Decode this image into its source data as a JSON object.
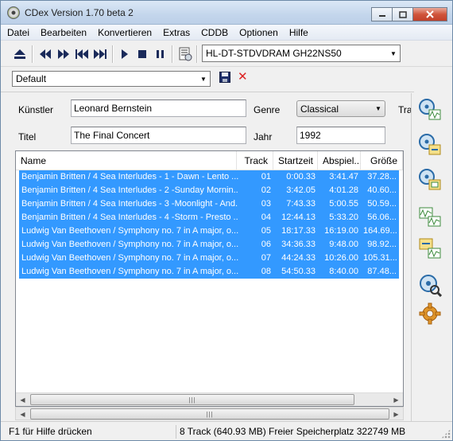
{
  "window": {
    "title": "CDex Version 1.70 beta 2"
  },
  "menu": [
    "Datei",
    "Bearbeiten",
    "Konvertieren",
    "Extras",
    "CDDB",
    "Optionen",
    "Hilfe"
  ],
  "toolbar": {
    "drive": "HL-DT-STDVDRAM GH22NS50",
    "icons": [
      "eject-icon",
      "rewind-icon",
      "fast-forward-icon",
      "skip-back-icon",
      "skip-forward-icon",
      "play-icon",
      "stop-icon",
      "pause-icon",
      "cd-info-icon"
    ]
  },
  "profile": {
    "selected": "Default"
  },
  "form": {
    "artist_label": "Künstler",
    "artist_value": "Leonard Bernstein",
    "title_label": "Titel",
    "title_value": "The Final Concert",
    "genre_label": "Genre",
    "genre_value": "Classical",
    "year_label": "Jahr",
    "year_value": "1992",
    "track_label_partial": "Tra"
  },
  "tracklist": {
    "columns": [
      "Name",
      "Track",
      "Startzeit",
      "Abspiel...",
      "Größe"
    ],
    "rows": [
      {
        "name": "Benjamin Britten / 4 Sea Interludes - 1 - Dawn - Lento ...",
        "track": "01",
        "start": "0:00.33",
        "play": "3:41.47",
        "size": "37.28..."
      },
      {
        "name": "Benjamin Britten / 4 Sea Interludes - 2 -Sunday Mornin...",
        "track": "02",
        "start": "3:42.05",
        "play": "4:01.28",
        "size": "40.60..."
      },
      {
        "name": "Benjamin Britten / 4 Sea Interludes - 3 -Moonlight - And...",
        "track": "03",
        "start": "7:43.33",
        "play": "5:00.55",
        "size": "50.59..."
      },
      {
        "name": "Benjamin Britten / 4 Sea Interludes - 4 -Storm - Presto ...",
        "track": "04",
        "start": "12:44.13",
        "play": "5:33.20",
        "size": "56.06..."
      },
      {
        "name": "Ludwig Van Beethoven / Symphony no. 7 in A major, o...",
        "track": "05",
        "start": "18:17.33",
        "play": "16:19.00",
        "size": "164.69..."
      },
      {
        "name": "Ludwig Van Beethoven / Symphony no. 7 in A major, o...",
        "track": "06",
        "start": "34:36.33",
        "play": "9:48.00",
        "size": "98.92..."
      },
      {
        "name": "Ludwig Van Beethoven / Symphony no. 7 in A major, o...",
        "track": "07",
        "start": "44:24.33",
        "play": "10:26.00",
        "size": "105.31..."
      },
      {
        "name": "Ludwig Van Beethoven / Symphony no. 7 in A major, o...",
        "track": "08",
        "start": "54:50.33",
        "play": "8:40.00",
        "size": "87.48..."
      }
    ]
  },
  "side_actions": [
    "rip-to-wav-icon",
    "rip-to-compressed-icon",
    "rip-partial-icon",
    "convert-wav-icon",
    "convert-compressed-icon",
    "playlist-icon",
    "settings-gear-icon"
  ],
  "status": {
    "help": "F1 für Hilfe drücken",
    "summary": "8 Track (640.93 MB) Freier Speicherplatz 322749 MB"
  }
}
